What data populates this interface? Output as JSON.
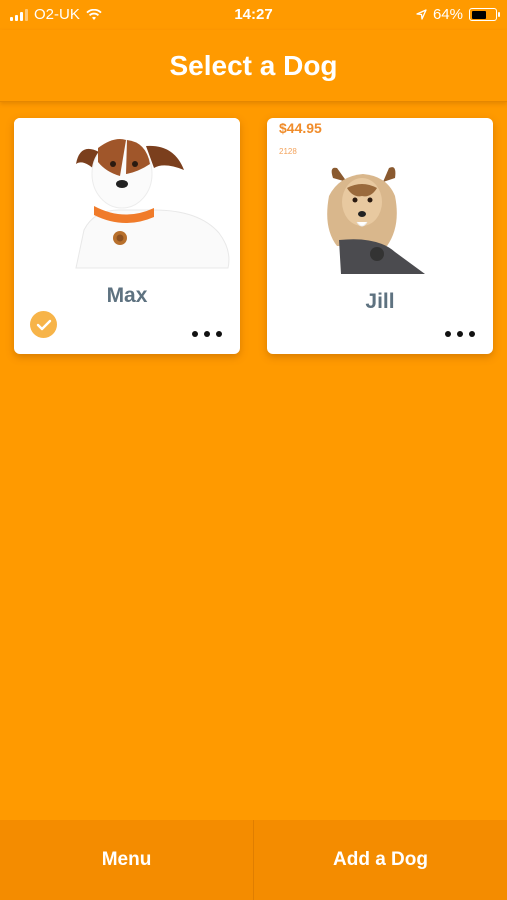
{
  "status_bar": {
    "carrier": "O2-UK",
    "time": "14:27",
    "battery": "64%",
    "battery_level": 0.64,
    "icons": [
      "signal-icon",
      "wifi-icon",
      "location-icon",
      "battery-icon"
    ]
  },
  "header": {
    "title": "Select a Dog"
  },
  "dogs": [
    {
      "name": "Max",
      "selected": true,
      "photo": "jack-russell-orange-collar"
    },
    {
      "name": "Jill",
      "selected": false,
      "photo": "sheltie-grey-harness",
      "price": "$44.95",
      "price_sub": "2128"
    }
  ],
  "bottom_bar": {
    "menu_label": "Menu",
    "add_label": "Add a Dog"
  },
  "colors": {
    "background": "#FF9A00",
    "bottom_bar": "#F48C00",
    "name_text": "#5E7280",
    "check": "#F7B449"
  }
}
